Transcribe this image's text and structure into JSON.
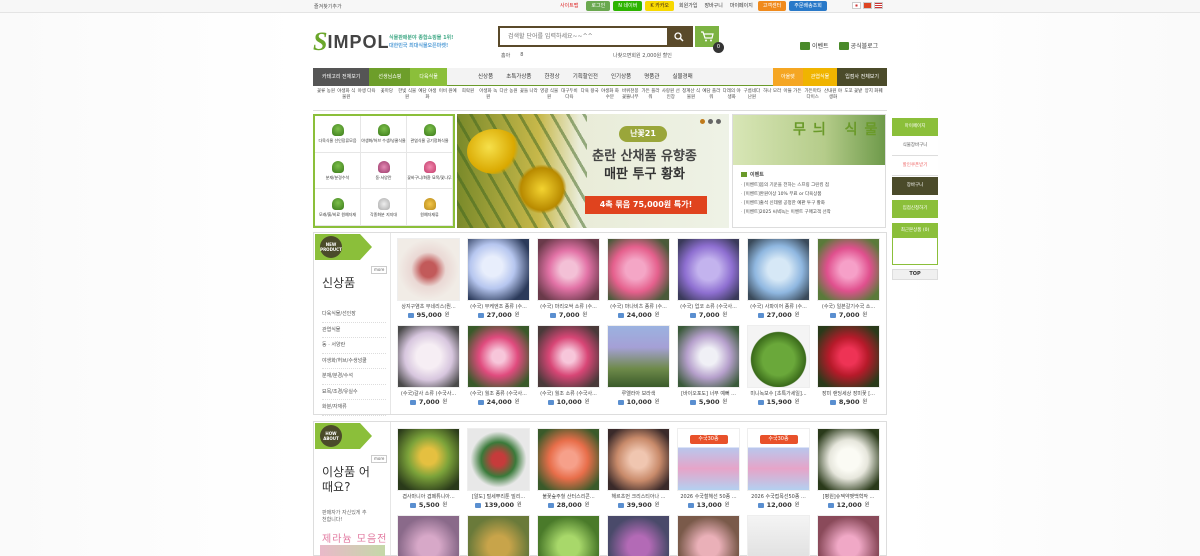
{
  "topbar": {
    "favorite": "즐겨찾기추가",
    "links": [
      "사이트맵",
      "로그인",
      "N 네이버",
      "K 카카오",
      "회원가입",
      "장바구니",
      "마이페이지",
      "고객센터",
      "주문배송조회"
    ]
  },
  "header": {
    "logo": "IMPOL",
    "tagline1": "식물판매분야 종합쇼핑몰 1위!",
    "tagline2": "대한민국 최대식물오픈마켓!",
    "search_placeholder": "검색할 단어를 입력하세요~~^^",
    "cart_count": "0",
    "sub_links": [
      "홈아",
      "8"
    ],
    "promo": "나찾으면회원 2,000원 할인",
    "right_links": [
      "이벤트",
      "공식블로그"
    ]
  },
  "gnb": {
    "left": [
      "카테고리 전체보기",
      "선생님쇼핑",
      "다육식물"
    ],
    "mid": [
      "신상품",
      "초특가상품",
      "한정상",
      "기획할인전",
      "인기상품",
      "명품관",
      "실물경매"
    ],
    "right": [
      "아울렛",
      "관엽식물",
      "입점사 전체보기"
    ]
  },
  "subcats": [
    "꽃류 농원",
    "야생화 식물원",
    "야생 다육",
    "꽃마당",
    "한빛 식물원",
    "예담 야생화",
    "이비 원예",
    "희락원",
    "아생화 녹원",
    "다산 농원",
    "꽃들 나라",
    "영광 식물원",
    "대구두비 다육",
    "다육 왕국",
    "야생화 화수분",
    "바위천봉 꽃뜰나무",
    "가든 플라워",
    "사랑원 선인장",
    "청계산 식물원",
    "예담 플라워",
    "다래의 야생화",
    "구름네다 난원",
    "하나 모라",
    "아뜰 가든",
    "가든마타 다이스",
    "산내원 야생화",
    "도꼬 꽃밭",
    "양지 화훼"
  ],
  "category_box": [
    {
      "label": "다육식물 선인장류모음"
    },
    {
      "label": "야생화/허브 수생/넝쿨식물"
    },
    {
      "label": "관엽식물 공기정화식물"
    },
    {
      "label": "분재/분경수석"
    },
    {
      "label": "동·서양란"
    },
    {
      "label": "꽃바구니/화환 묘목/꽃나무"
    },
    {
      "label": "모래/흙/비료 원예자재"
    },
    {
      "label": "각종화분 지지대"
    },
    {
      "label": "원예자재류"
    }
  ],
  "banner": {
    "badge": "난꽃21",
    "line1": "춘란 산채품 유향종",
    "line2": "매판 투구 황화",
    "line3": "4촉 묶음 75,000원 특가!"
  },
  "right_panel": {
    "title": "무늬 식물",
    "event_title": "이벤트",
    "events": [
      "[이벤트]봄의 기운을 전하는 스프링 그린킹 점",
      "[이벤트]완원이상 10% 무료 or 다육상품",
      "[이벤트]출석 신데렐 공정한 예판 투구 황화",
      "[이벤트]2025 씨넥녹는 이벤트 구매고객 선착"
    ]
  },
  "quick_menu": {
    "items": [
      "마이페이지",
      "식물장바구니",
      "할인쿠폰받기",
      "장바구니",
      "입점신청하기"
    ],
    "recent": "최근본상품 (0)",
    "top": "TOP"
  },
  "section1": {
    "badge": "NEW PRODUCT",
    "more": "more",
    "title": "신상품",
    "categories": [
      "다육식물/선인장",
      "관엽식물",
      "동 · 서양란",
      "야생화/허브/수생넝쿨",
      "분재/분경/수석",
      "묘목/조경/유실수",
      "화분/자재류"
    ],
    "products": [
      {
        "name": "상지구염초 무네리스(뭔...",
        "price": "95,000"
      },
      {
        "name": "(수국) 부케엔조 종류 (수...",
        "price": "27,000"
      },
      {
        "name": "(수국) 마리오싹 소류 (수...",
        "price": "7,000"
      },
      {
        "name": "(수국) 마나비츠 종류 (수...",
        "price": "24,000"
      },
      {
        "name": "(수국) 업코 소류 (수국사...",
        "price": "7,000"
      },
      {
        "name": "(수국) 사파이어 종류 (수...",
        "price": "27,000"
      },
      {
        "name": "(수국) 일본갈기수국 소...",
        "price": "7,000"
      },
      {
        "name": "(수국)갈사 소류 (수국사...",
        "price": "7,000"
      },
      {
        "name": "(수국) 월조 종류 (수국사...",
        "price": "24,000"
      },
      {
        "name": "(수국) 월조 소류 (수국사...",
        "price": "10,000"
      },
      {
        "name": "루엘라아 보라색",
        "price": "10,000"
      },
      {
        "name": "[바이오포도] 너무 예뻐 ...",
        "price": "5,900"
      },
      {
        "name": "미니녹보수 [초특가세일]...",
        "price": "15,900"
      },
      {
        "name": "장미 랜딩세상 장미꽃 [...",
        "price": "8,900"
      }
    ]
  },
  "section2": {
    "badge": "HOW ABOUT",
    "more": "more",
    "title": "이상품 어때요?",
    "subtitle": "판매자가 자신있게 추천합니다!",
    "geranium": "제라늄 모음전",
    "products": [
      {
        "name": "겹사마니아 겹페튜니아...",
        "price": "5,500"
      },
      {
        "name": "[알도] 털세뿌리툰 빌리...",
        "price": "139,000"
      },
      {
        "name": "불꽃숲주헐 산터스리콘...",
        "price": "28,000"
      },
      {
        "name": "해르초먼 크리스티아나 ...",
        "price": "39,900"
      },
      {
        "name": "2026 수국철헤선 50종 ...",
        "price": "13,000"
      },
      {
        "name": "2026 수국접목선50종 ...",
        "price": "12,000"
      },
      {
        "name": "[평원]슈젝약팻백혁작 ...",
        "price": "12,000"
      },
      {
        "name": "",
        "price": ""
      },
      {
        "name": "",
        "price": ""
      },
      {
        "name": "",
        "price": ""
      },
      {
        "name": "",
        "price": ""
      },
      {
        "name": "",
        "price": ""
      },
      {
        "name": "",
        "price": ""
      },
      {
        "name": "",
        "price": ""
      }
    ]
  },
  "currency": "원"
}
